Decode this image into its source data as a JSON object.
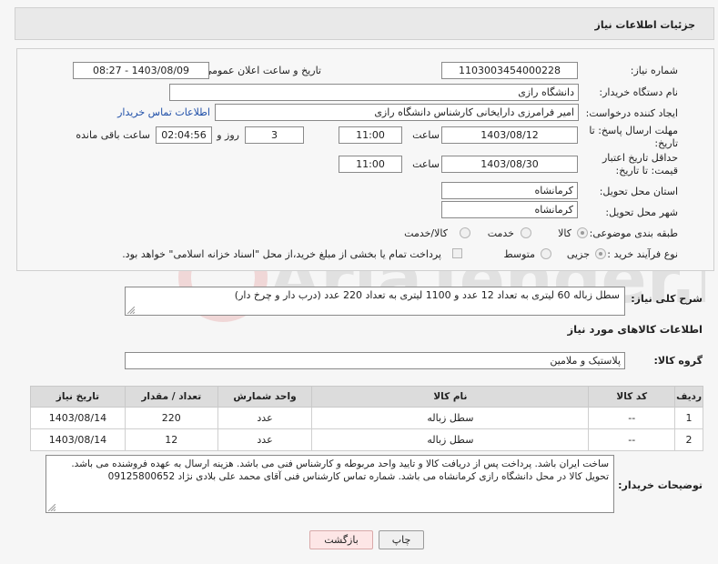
{
  "header": {
    "title": "جزئیات اطلاعات نیاز"
  },
  "form": {
    "need_number": {
      "label": "شماره نیاز:",
      "value": "1103003454000228"
    },
    "announce_datetime": {
      "label": "تاریخ و ساعت اعلان عمومی:",
      "value": "1403/08/09 - 08:27"
    },
    "buyer_org": {
      "label": "نام دستگاه خریدار:",
      "value": "دانشگاه رازی"
    },
    "creator": {
      "label": "ایجاد کننده درخواست:",
      "value": "امیر فرامرزی دارایخانی کارشناس دانشگاه رازی",
      "contact_link": "اطلاعات تماس خریدار"
    },
    "reply_deadline": {
      "label": "مهلت ارسال پاسخ: تا تاریخ:",
      "date": "1403/08/12",
      "time_label": "ساعت",
      "time": "11:00",
      "days": "3",
      "days_label": "روز و",
      "remaining": "02:04:56",
      "remaining_label": "ساعت باقی مانده"
    },
    "price_validity": {
      "label": "حداقل تاریخ اعتبار قیمت: تا تاریخ:",
      "date": "1403/08/30",
      "time_label": "ساعت",
      "time": "11:00"
    },
    "delivery_province": {
      "label": "استان محل تحویل:",
      "value": "کرمانشاه"
    },
    "delivery_city": {
      "label": "شهر محل تحویل:",
      "value": "کرمانشاه"
    },
    "subject_class": {
      "label": "طبقه بندی موضوعی:",
      "options": [
        "کالا",
        "خدمت",
        "کالا/خدمت"
      ]
    },
    "purchase_process": {
      "label": "نوع فرآیند خرید :",
      "options": [
        "جزیی",
        "متوسط"
      ],
      "note": "پرداخت تمام یا بخشی از مبلغ خرید،از محل \"اسناد خزانه اسلامی\" خواهد بود."
    }
  },
  "summary": {
    "label": "شرح کلی نیاز:",
    "value": "سطل زباله 60 لیتری به تعداد 12 عدد و  1100 لیتری به تعداد 220 عدد (درب دار و چرخ دار)"
  },
  "goods_info": {
    "title": "اطلاعات کالاهای مورد نیاز"
  },
  "goods_group": {
    "label": "گروه کالا:",
    "value": "پلاستیک و ملامین"
  },
  "table": {
    "headers": [
      "ردیف",
      "کد کالا",
      "نام کالا",
      "واحد شمارش",
      "تعداد / مقدار",
      "تاریخ نیاز"
    ],
    "rows": [
      [
        "1",
        "--",
        "سطل زباله",
        "عدد",
        "220",
        "1403/08/14"
      ],
      [
        "2",
        "--",
        "سطل زباله",
        "عدد",
        "12",
        "1403/08/14"
      ]
    ]
  },
  "buyer_notes": {
    "label": "توضیحات خریدار:",
    "value": "ساخت ایران باشد. پرداخت پس از دریافت کالا و تایید واحد مربوطه و کارشناس فنی می باشد. هزینه ارسال به عهده فروشنده می باشد. تحویل کالا در محل دانشگاه رازی کرمانشاه می باشد. شماره تماس کارشناس فنی آقای محمد علی بلادی نژاد 09125800652"
  },
  "buttons": {
    "print": "چاپ",
    "back": "بازگشت"
  },
  "colors": {
    "link": "#1f4fa8",
    "header_bg": "#e9e9e9",
    "back_button_bg": "#fde6e6"
  }
}
